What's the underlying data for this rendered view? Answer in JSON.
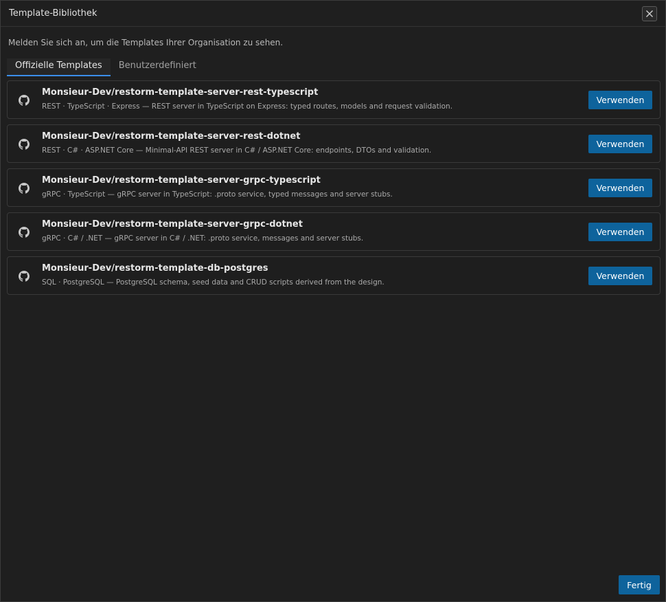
{
  "dialog": {
    "title": "Template-Bibliothek",
    "close_icon": "close-icon"
  },
  "info_text": "Melden Sie sich an, um die Templates Ihrer Organisation zu sehen.",
  "tabs": [
    {
      "label": "Offizielle Templates",
      "active": true
    },
    {
      "label": "Benutzerdefiniert",
      "active": false
    }
  ],
  "templates": [
    {
      "icon": "github-icon",
      "name": "Monsieur-Dev/restorm-template-server-rest-typescript",
      "description": "REST · TypeScript · Express — REST server in TypeScript on Express: typed routes, models and request validation.",
      "button_label": "Verwenden"
    },
    {
      "icon": "github-icon",
      "name": "Monsieur-Dev/restorm-template-server-rest-dotnet",
      "description": "REST · C# · ASP.NET Core — Minimal-API REST server in C# / ASP.NET Core: endpoints, DTOs and validation.",
      "button_label": "Verwenden"
    },
    {
      "icon": "github-icon",
      "name": "Monsieur-Dev/restorm-template-server-grpc-typescript",
      "description": "gRPC · TypeScript — gRPC server in TypeScript: .proto service, typed messages and server stubs.",
      "button_label": "Verwenden"
    },
    {
      "icon": "github-icon",
      "name": "Monsieur-Dev/restorm-template-server-grpc-dotnet",
      "description": "gRPC · C# / .NET — gRPC server in C# / .NET: .proto service, messages and server stubs.",
      "button_label": "Verwenden"
    },
    {
      "icon": "github-icon",
      "name": "Monsieur-Dev/restorm-template-db-postgres",
      "description": "SQL · PostgreSQL — PostgreSQL schema, seed data and CRUD scripts derived from the design.",
      "button_label": "Verwenden"
    }
  ],
  "footer": {
    "done_label": "Fertig"
  },
  "colors": {
    "accent": "#0e639c",
    "tab_indicator": "#3b8eea",
    "background": "#1f1f1f"
  }
}
